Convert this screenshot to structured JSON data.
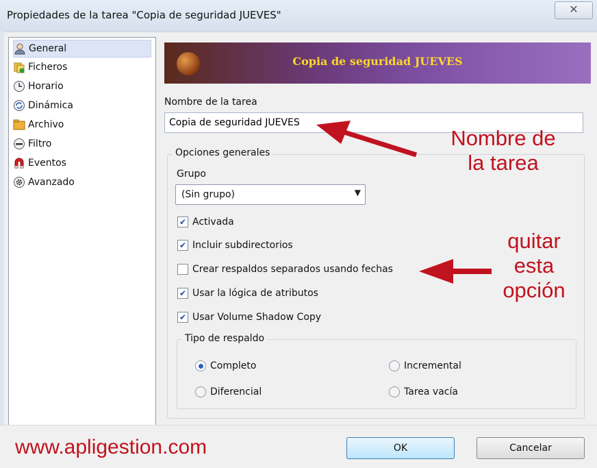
{
  "window": {
    "title": "Propiedades de la tarea \"Copia de seguridad JUEVES\"",
    "close_glyph": "✕"
  },
  "sidebar": {
    "items": [
      {
        "label": "General",
        "icon": "user-icon",
        "selected": true
      },
      {
        "label": "Ficheros",
        "icon": "files-icon",
        "selected": false
      },
      {
        "label": "Horario",
        "icon": "clock-icon",
        "selected": false
      },
      {
        "label": "Dinámica",
        "icon": "refresh-icon",
        "selected": false
      },
      {
        "label": "Archivo",
        "icon": "archive-icon",
        "selected": false
      },
      {
        "label": "Filtro",
        "icon": "filter-icon",
        "selected": false
      },
      {
        "label": "Eventos",
        "icon": "magnet-icon",
        "selected": false
      },
      {
        "label": "Avanzado",
        "icon": "gear-icon",
        "selected": false
      }
    ]
  },
  "banner": {
    "title": "Copia de seguridad JUEVES",
    "title_color": "#ffd62a"
  },
  "task_name": {
    "label": "Nombre de la tarea",
    "value": "Copia de seguridad JUEVES"
  },
  "general_options": {
    "legend": "Opciones generales",
    "group_label": "Grupo",
    "group_value": "(Sin grupo)",
    "checkboxes": [
      {
        "label": "Activada",
        "checked": true
      },
      {
        "label": "Incluir subdirectorios",
        "checked": true
      },
      {
        "label": "Crear respaldos separados usando fechas",
        "checked": false
      },
      {
        "label": "Usar la lógica de atributos",
        "checked": true
      },
      {
        "label": "Usar Volume Shadow Copy",
        "checked": true
      }
    ]
  },
  "backup_type": {
    "legend": "Tipo de respaldo",
    "options": [
      {
        "label": "Completo",
        "selected": true
      },
      {
        "label": "Incremental",
        "selected": false
      },
      {
        "label": "Diferencial",
        "selected": false
      },
      {
        "label": "Tarea vacía",
        "selected": false
      }
    ]
  },
  "annotations": {
    "name_note_line1": "Nombre de",
    "name_note_line2": "la tarea",
    "remove_note_line1": "quitar",
    "remove_note_line2": "esta",
    "remove_note_line3": "opción",
    "website": "www.apligestion.com",
    "color": "#c1121f"
  },
  "buttons": {
    "ok": "OK",
    "cancel": "Cancelar"
  }
}
